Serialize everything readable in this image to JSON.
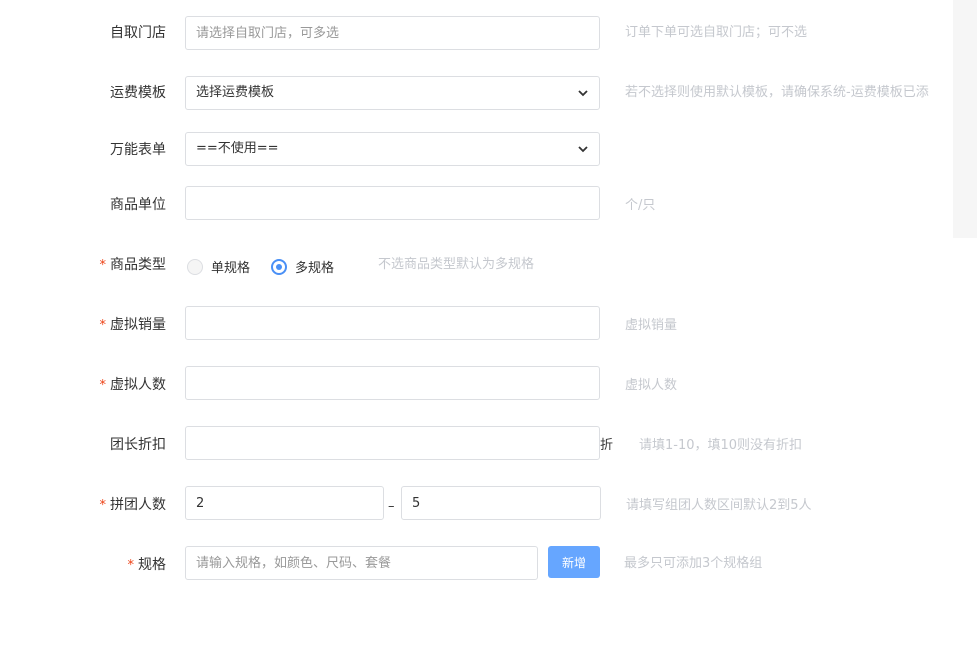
{
  "form": {
    "pickup_store": {
      "label": "自取门店",
      "placeholder": "请选择自取门店，可多选",
      "hint": "订单下单可选自取门店；可不选"
    },
    "shipping_template": {
      "label": "运费模板",
      "value": "选择运费模板",
      "hint": "若不选择则使用默认模板，请确保系统-运费模板已添"
    },
    "universal_form": {
      "label": "万能表单",
      "value": "==不使用=="
    },
    "unit": {
      "label": "商品单位",
      "value": "",
      "hint": "个/只"
    },
    "product_type": {
      "required_mark": "*",
      "label": "商品类型",
      "options": [
        "单规格",
        "多规格"
      ],
      "selected": "多规格",
      "hint": "不选商品类型默认为多规格"
    },
    "virtual_sales": {
      "required_mark": "*",
      "label": "虚拟销量",
      "value": "",
      "hint": "虚拟销量"
    },
    "virtual_people": {
      "required_mark": "*",
      "label": "虚拟人数",
      "value": "",
      "hint": "虚拟人数"
    },
    "leader_discount": {
      "label": "团长折扣",
      "value": "",
      "suffix": "折",
      "hint": "请填1-10，填10则没有折扣"
    },
    "group_size": {
      "required_mark": "*",
      "label": "拼团人数",
      "min": "2",
      "max": "5",
      "separator": "–",
      "hint": "请填写组团人数区间默认2到5人"
    },
    "spec": {
      "required_mark": "*",
      "label": "规格",
      "placeholder": "请输入规格，如颜色、尺码、套餐",
      "button": "新增",
      "hint": "最多只可添加3个规格组"
    }
  },
  "colors": {
    "primary": "#4a90f6",
    "button": "#66a6ff",
    "required": "#ed4014",
    "hint": "#c5c8ce"
  },
  "icons": {
    "select_arrow": "chevron-down-icon"
  }
}
